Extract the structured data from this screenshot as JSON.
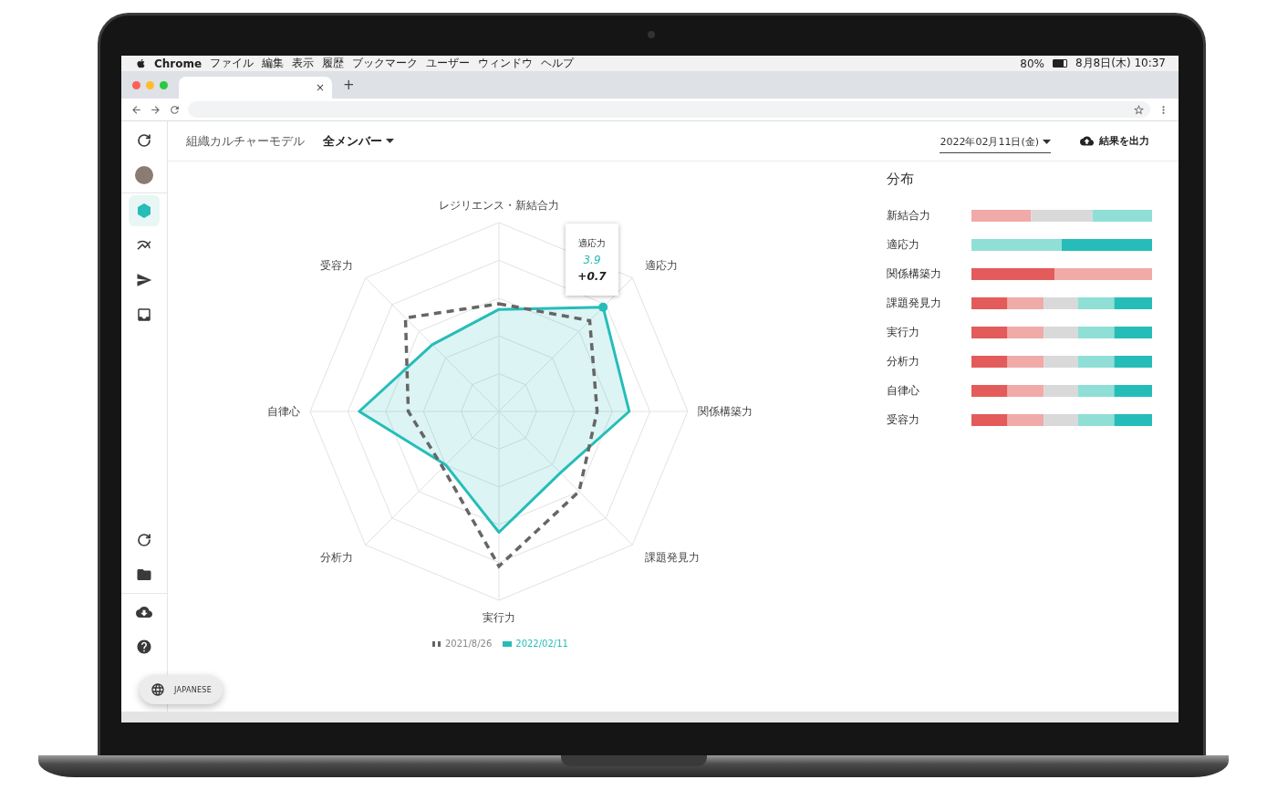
{
  "menubar": {
    "app": "Chrome",
    "menus": [
      "ファイル",
      "編集",
      "表示",
      "履歴",
      "ブックマーク",
      "ユーザー",
      "ウィンドウ",
      "ヘルプ"
    ],
    "battery": "80%",
    "clock": "8月8日(木) 10:37"
  },
  "browser": {
    "tab_close": "×",
    "new_tab": "+"
  },
  "sidebar": {
    "top": [
      {
        "kind": "refresh",
        "selected": false
      },
      {
        "kind": "avatar",
        "selected": false
      },
      {
        "kind": "hexagon",
        "selected": true
      },
      {
        "kind": "trend",
        "selected": false
      },
      {
        "kind": "send",
        "selected": false
      },
      {
        "kind": "inbox",
        "selected": false
      }
    ],
    "bottom": [
      {
        "kind": "refresh"
      },
      {
        "kind": "folder"
      },
      {
        "kind": "download"
      },
      {
        "kind": "help"
      }
    ]
  },
  "language": "JAPANESE",
  "header": {
    "title": "組織カルチャーモデル",
    "member_filter": "全メンバー",
    "date": "2022年02月11日(金)",
    "export": "結果を出力"
  },
  "radar": {
    "axes": [
      "レジリエンス・新結合力",
      "適応力",
      "関係構築力",
      "課題発見力",
      "実行力",
      "分析力",
      "自律心",
      "受容力"
    ],
    "tooltip": {
      "label": "適応力",
      "value": "3.9",
      "change": "+0.7"
    },
    "legend": [
      {
        "label": "2021/8/26",
        "kind": "dashed",
        "color": "#666666"
      },
      {
        "label": "2022/02/11",
        "kind": "solid",
        "color": "#26bdb8"
      }
    ]
  },
  "distribution": {
    "title": "分布",
    "rows": [
      {
        "label": "新結合力"
      },
      {
        "label": "適応力"
      },
      {
        "label": "関係構築力"
      },
      {
        "label": "課題発見力"
      },
      {
        "label": "実行力"
      },
      {
        "label": "分析力"
      },
      {
        "label": "自律心"
      },
      {
        "label": "受容力"
      }
    ]
  }
}
